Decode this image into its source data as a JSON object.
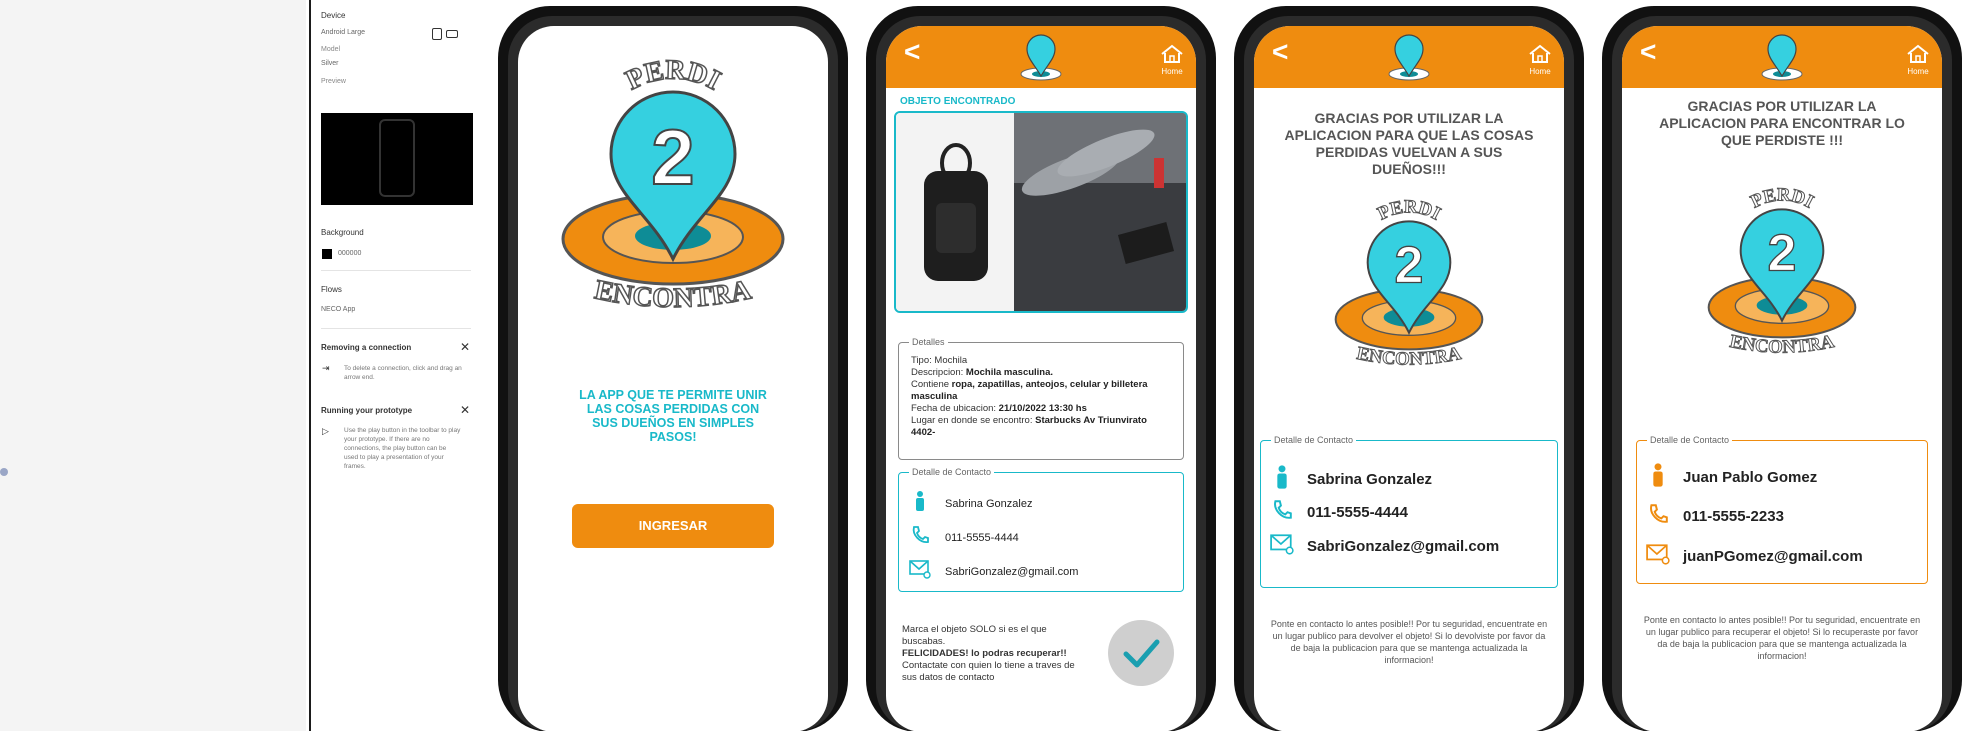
{
  "panel": {
    "device_label": "Device",
    "device_value": "Android Large",
    "model_label": "Model",
    "model_value": "Silver",
    "preview_label": "Preview",
    "background_label": "Background",
    "background_value": "000000",
    "flows_label": "Flows",
    "flows_value": "NECO App",
    "removing_title": "Removing a connection",
    "removing_desc": "To delete a connection, click and drag an arrow end.",
    "running_title": "Running your prototype",
    "running_desc": "Use the play button in the toolbar to play your prototype. If there are no connections, the play button can be used to play a presentation of your frames."
  },
  "logo": {
    "top_word": "PERDI",
    "digit": "2",
    "bottom_word": "ENCONTRA"
  },
  "header": {
    "back_glyph": "<",
    "home_label": "Home"
  },
  "screen1": {
    "tagline": "LA APP QUE TE PERMITE UNIR LAS COSAS PERDIDAS CON SUS DUEÑOS EN SIMPLES PASOS!",
    "button": "INGRESAR"
  },
  "screen2": {
    "section_title": "OBJETO ENCONTRADO",
    "details_legend": "Detalles",
    "details": [
      {
        "k": "Tipo:",
        "v": " Mochila",
        "bold": false
      },
      {
        "k": "Descripcion:",
        "v": " Mochila masculina.",
        "bold": true
      },
      {
        "k": "Contiene",
        "v": " ropa, zapatillas, anteojos, celular y billetera masculina",
        "bold": true
      },
      {
        "k": "Fecha de ubicacion:",
        "v": " 21/10/2022  13:30 hs",
        "bold": true
      },
      {
        "k": "Lugar en donde se encontro:",
        "v": " Starbucks Av Triunvirato 4402-",
        "bold": true
      }
    ],
    "contact_legend": "Detalle de Contacto",
    "contact_name": "Sabrina Gonzalez",
    "contact_phone": "011-5555-4444",
    "contact_email": "SabriGonzalez@gmail.com",
    "note_l1": "Marca el objeto SOLO si es el que buscabas.",
    "note_l2": "FELICIDADES! lo podras recuperar!!",
    "note_l3": "Contactate con quien lo tiene a traves de sus datos de contacto"
  },
  "screen3": {
    "heading": "GRACIAS POR UTILIZAR LA APLICACION PARA QUE  LAS COSAS PERDIDAS VUELVAN A SUS DUEÑOS!!!",
    "contact_legend": "Detalle de Contacto",
    "contact_name": "Sabrina Gonzalez",
    "contact_phone": "011-5555-4444",
    "contact_email": "SabriGonzalez@gmail.com",
    "footer": "Ponte en contacto lo antes posible!! Por tu seguridad, encuentrate en un lugar publico para devolver el objeto! Si lo devolviste por favor da de baja la publicacion para que se mantenga actualizada la informacion!"
  },
  "screen4": {
    "heading": "GRACIAS POR UTILIZAR LA APLICACION PARA ENCONTRAR LO QUE PERDISTE !!!",
    "contact_legend": "Detalle de Contacto",
    "contact_name": "Juan Pablo Gomez",
    "contact_phone": "011-5555-2233",
    "contact_email": "juanPGomez@gmail.com",
    "footer": "Ponte en contacto lo antes posible!! Por tu seguridad, encuentrate en un lugar publico para recuperar el objeto! Si lo recuperaste por favor da de baja la publicacion para que se mantenga actualizada la informacion!"
  },
  "colors": {
    "accent_orange": "#ef8c0f",
    "accent_teal": "#19b9c9",
    "pin_cyan": "#35d0e0"
  }
}
